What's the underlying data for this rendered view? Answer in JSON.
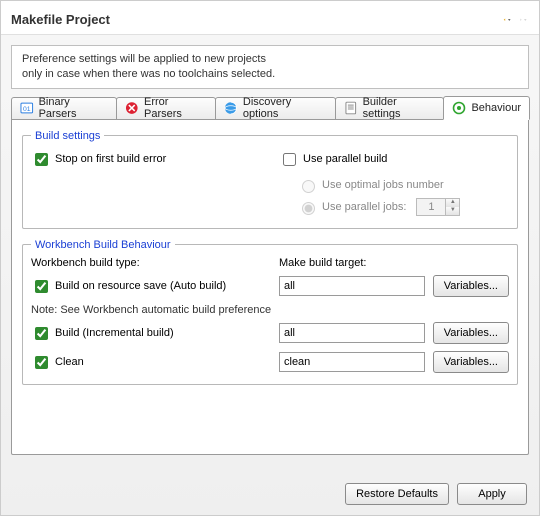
{
  "header": {
    "title": "Makefile Project"
  },
  "description": {
    "line1": "Preference settings will be applied to new projects",
    "line2": "only in case when there was no toolchains selected."
  },
  "tabs": {
    "binary": "Binary Parsers",
    "error": "Error Parsers",
    "discovery": "Discovery options",
    "builder": "Builder settings",
    "behaviour": "Behaviour"
  },
  "build_settings": {
    "legend": "Build settings",
    "stop_on_error": "Stop on first build error",
    "use_parallel": "Use parallel build",
    "optimal_jobs": "Use optimal jobs number",
    "parallel_jobs": "Use parallel jobs:",
    "parallel_jobs_value": "1"
  },
  "workbench": {
    "legend": "Workbench Build Behaviour",
    "col_type": "Workbench build type:",
    "col_target": "Make build target:",
    "build_on_save": "Build on resource save (Auto build)",
    "build_on_save_target": "all",
    "note": "Note: See Workbench automatic build preference",
    "build_incremental": "Build (Incremental build)",
    "build_incremental_target": "all",
    "clean": "Clean",
    "clean_target": "clean",
    "variables_btn": "Variables..."
  },
  "footer": {
    "restore": "Restore Defaults",
    "apply": "Apply"
  }
}
